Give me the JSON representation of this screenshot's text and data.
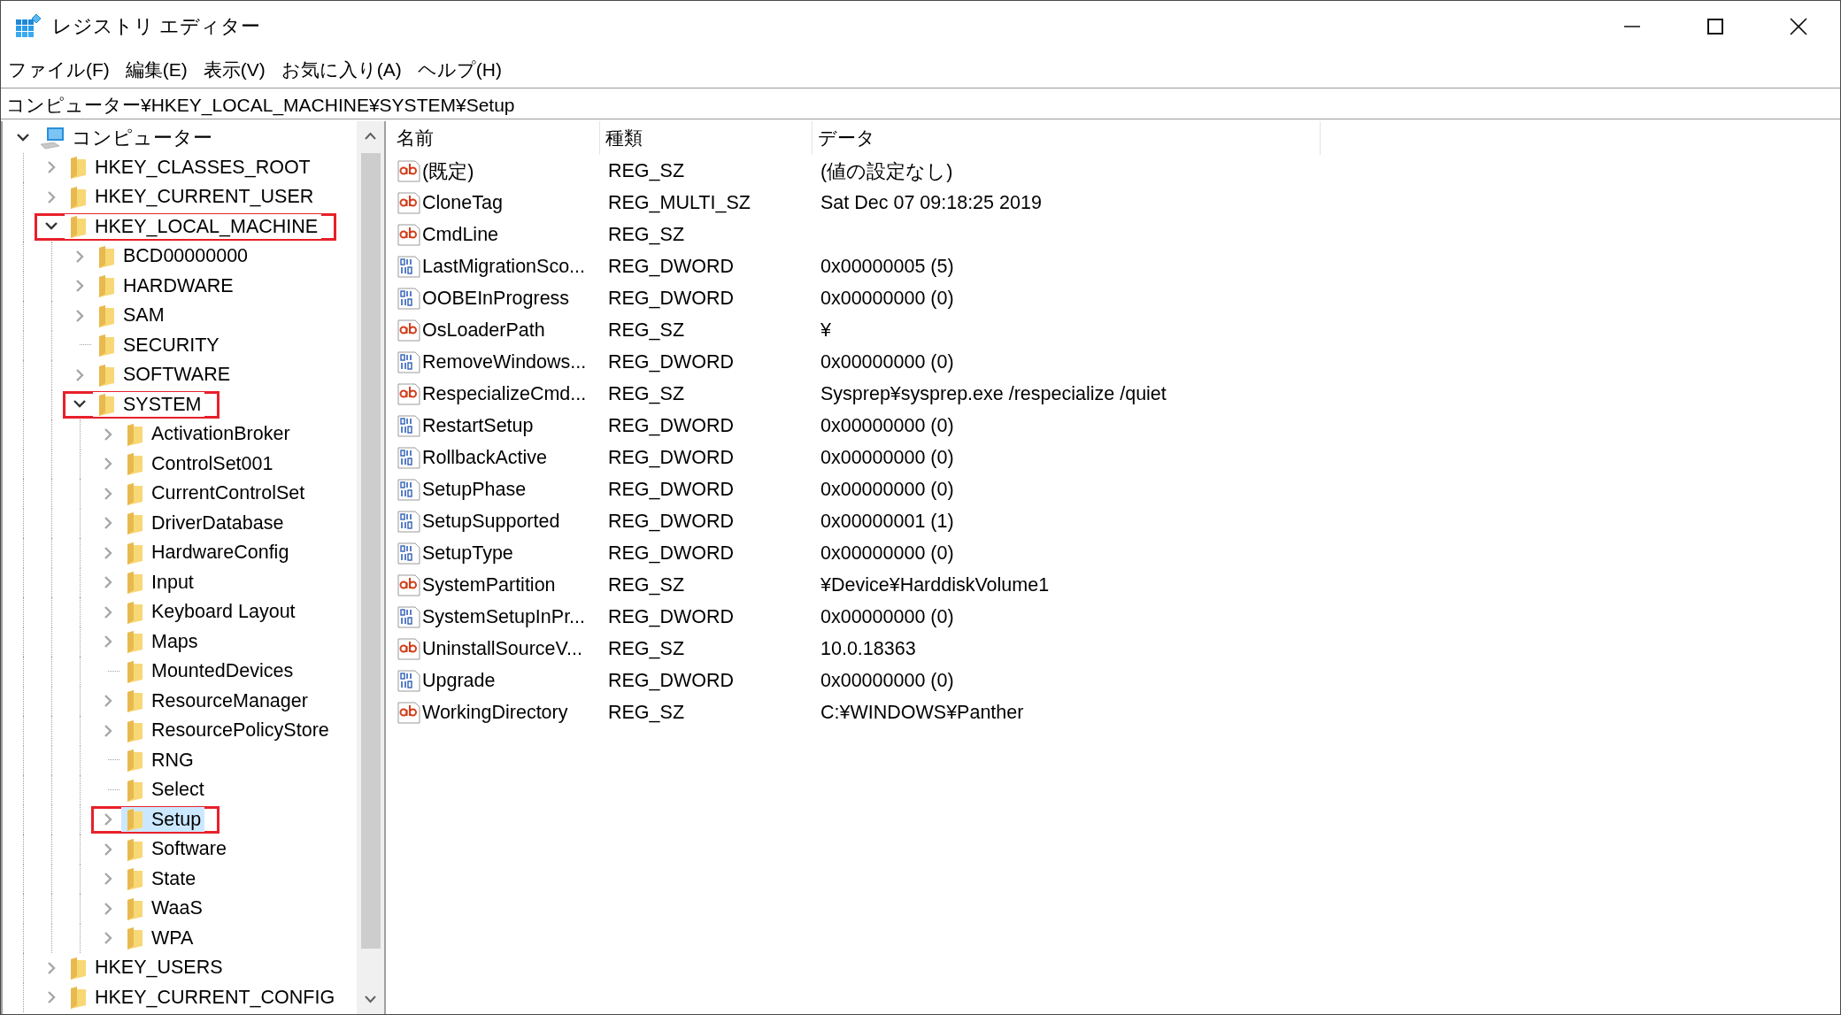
{
  "window": {
    "title": "レジストリ エディター"
  },
  "menu": [
    "ファイル(F)",
    "編集(E)",
    "表示(V)",
    "お気に入り(A)",
    "ヘルプ(H)"
  ],
  "address": {
    "value": "コンピューター¥HKEY_LOCAL_MACHINE¥SYSTEM¥Setup"
  },
  "tree": [
    {
      "label": "コンピューター",
      "kind": "computer",
      "expanded": true,
      "selected": false,
      "highlighted": false,
      "children": [
        {
          "label": "HKEY_CLASSES_ROOT",
          "kind": "folder",
          "expanded": false,
          "selected": false,
          "highlighted": false
        },
        {
          "label": "HKEY_CURRENT_USER",
          "kind": "folder",
          "expanded": false,
          "selected": false,
          "highlighted": false
        },
        {
          "label": "HKEY_LOCAL_MACHINE",
          "kind": "folder",
          "expanded": true,
          "selected": false,
          "highlighted": true,
          "children": [
            {
              "label": "BCD00000000",
              "kind": "folder",
              "expanded": false,
              "selected": false,
              "highlighted": false
            },
            {
              "label": "HARDWARE",
              "kind": "folder",
              "expanded": false,
              "selected": false,
              "highlighted": false
            },
            {
              "label": "SAM",
              "kind": "folder",
              "expanded": false,
              "selected": false,
              "highlighted": false
            },
            {
              "label": "SECURITY",
              "kind": "folder",
              "selected": false,
              "highlighted": false
            },
            {
              "label": "SOFTWARE",
              "kind": "folder",
              "expanded": false,
              "selected": false,
              "highlighted": false
            },
            {
              "label": "SYSTEM",
              "kind": "folder",
              "expanded": true,
              "selected": false,
              "highlighted": true,
              "children": [
                {
                  "label": "ActivationBroker",
                  "kind": "folder",
                  "expanded": false,
                  "selected": false,
                  "highlighted": false
                },
                {
                  "label": "ControlSet001",
                  "kind": "folder",
                  "expanded": false,
                  "selected": false,
                  "highlighted": false
                },
                {
                  "label": "CurrentControlSet",
                  "kind": "folder",
                  "expanded": false,
                  "selected": false,
                  "highlighted": false
                },
                {
                  "label": "DriverDatabase",
                  "kind": "folder",
                  "expanded": false,
                  "selected": false,
                  "highlighted": false
                },
                {
                  "label": "HardwareConfig",
                  "kind": "folder",
                  "expanded": false,
                  "selected": false,
                  "highlighted": false
                },
                {
                  "label": "Input",
                  "kind": "folder",
                  "expanded": false,
                  "selected": false,
                  "highlighted": false
                },
                {
                  "label": "Keyboard Layout",
                  "kind": "folder",
                  "expanded": false,
                  "selected": false,
                  "highlighted": false
                },
                {
                  "label": "Maps",
                  "kind": "folder",
                  "expanded": false,
                  "selected": false,
                  "highlighted": false
                },
                {
                  "label": "MountedDevices",
                  "kind": "folder",
                  "selected": false,
                  "highlighted": false
                },
                {
                  "label": "ResourceManager",
                  "kind": "folder",
                  "expanded": false,
                  "selected": false,
                  "highlighted": false
                },
                {
                  "label": "ResourcePolicyStore",
                  "kind": "folder",
                  "expanded": false,
                  "selected": false,
                  "highlighted": false
                },
                {
                  "label": "RNG",
                  "kind": "folder",
                  "selected": false,
                  "highlighted": false
                },
                {
                  "label": "Select",
                  "kind": "folder",
                  "selected": false,
                  "highlighted": false
                },
                {
                  "label": "Setup",
                  "kind": "folder",
                  "expanded": false,
                  "selected": true,
                  "highlighted": true
                },
                {
                  "label": "Software",
                  "kind": "folder",
                  "expanded": false,
                  "selected": false,
                  "highlighted": false
                },
                {
                  "label": "State",
                  "kind": "folder",
                  "expanded": false,
                  "selected": false,
                  "highlighted": false
                },
                {
                  "label": "WaaS",
                  "kind": "folder",
                  "expanded": false,
                  "selected": false,
                  "highlighted": false
                },
                {
                  "label": "WPA",
                  "kind": "folder",
                  "expanded": false,
                  "selected": false,
                  "highlighted": false
                }
              ]
            }
          ]
        },
        {
          "label": "HKEY_USERS",
          "kind": "folder",
          "expanded": false,
          "selected": false,
          "highlighted": false
        },
        {
          "label": "HKEY_CURRENT_CONFIG",
          "kind": "folder",
          "expanded": false,
          "selected": false,
          "highlighted": false
        }
      ]
    }
  ],
  "values": {
    "columns": [
      "名前",
      "種類",
      "データ"
    ],
    "rows": [
      {
        "kind": "string",
        "name": "(既定)",
        "type": "REG_SZ",
        "data": "(値の設定なし)"
      },
      {
        "kind": "string",
        "name": "CloneTag",
        "type": "REG_MULTI_SZ",
        "data": "Sat Dec 07 09:18:25 2019"
      },
      {
        "kind": "string",
        "name": "CmdLine",
        "type": "REG_SZ"
      },
      {
        "kind": "dword",
        "name": "LastMigrationSco...",
        "type": "REG_DWORD",
        "data": "0x00000005 (5)"
      },
      {
        "kind": "dword",
        "name": "OOBEInProgress",
        "type": "REG_DWORD",
        "data": "0x00000000 (0)"
      },
      {
        "kind": "string",
        "name": "OsLoaderPath",
        "type": "REG_SZ",
        "data": "¥"
      },
      {
        "kind": "dword",
        "name": "RemoveWindows...",
        "type": "REG_DWORD",
        "data": "0x00000000 (0)"
      },
      {
        "kind": "string",
        "name": "RespecializeCmd...",
        "type": "REG_SZ",
        "data": "Sysprep¥sysprep.exe /respecialize /quiet"
      },
      {
        "kind": "dword",
        "name": "RestartSetup",
        "type": "REG_DWORD",
        "data": "0x00000000 (0)"
      },
      {
        "kind": "dword",
        "name": "RollbackActive",
        "type": "REG_DWORD",
        "data": "0x00000000 (0)"
      },
      {
        "kind": "dword",
        "name": "SetupPhase",
        "type": "REG_DWORD",
        "data": "0x00000000 (0)"
      },
      {
        "kind": "dword",
        "name": "SetupSupported",
        "type": "REG_DWORD",
        "data": "0x00000001 (1)"
      },
      {
        "kind": "dword",
        "name": "SetupType",
        "type": "REG_DWORD",
        "data": "0x00000000 (0)"
      },
      {
        "kind": "string",
        "name": "SystemPartition",
        "type": "REG_SZ",
        "data": "¥Device¥HarddiskVolume1"
      },
      {
        "kind": "dword",
        "name": "SystemSetupInPr...",
        "type": "REG_DWORD",
        "data": "0x00000000 (0)"
      },
      {
        "kind": "string",
        "name": "UninstallSourceV...",
        "type": "REG_SZ",
        "data": "10.0.18363"
      },
      {
        "kind": "dword",
        "name": "Upgrade",
        "type": "REG_DWORD",
        "data": "0x00000000 (0)"
      },
      {
        "kind": "string",
        "name": "WorkingDirectory",
        "type": "REG_SZ",
        "data": "C:¥WINDOWS¥Panther"
      }
    ]
  }
}
